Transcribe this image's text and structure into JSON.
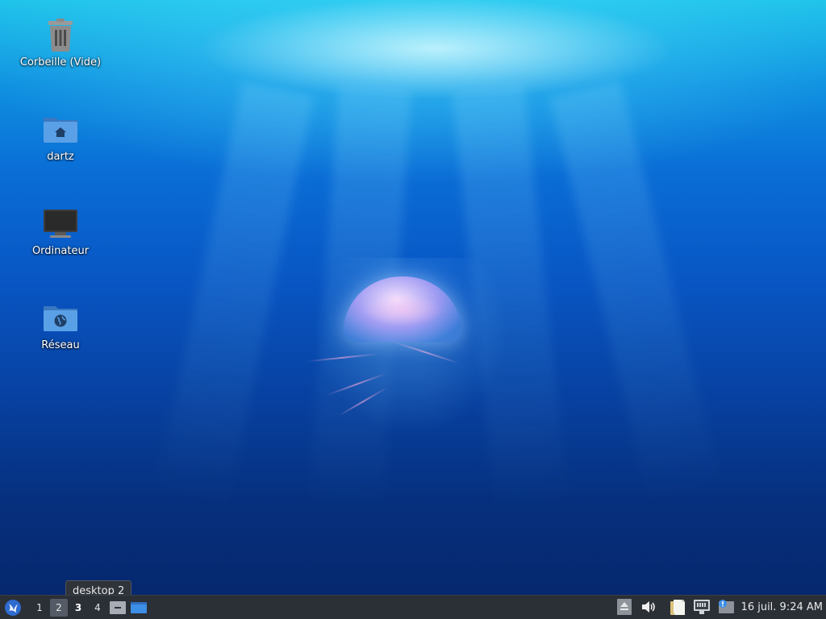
{
  "desktop": {
    "icons": [
      {
        "label": "Corbeille (Vide)",
        "icon": "trash-icon"
      },
      {
        "label": "dartz",
        "icon": "home-folder-icon"
      },
      {
        "label": "Ordinateur",
        "icon": "computer-icon"
      },
      {
        "label": "Réseau",
        "icon": "network-folder-icon"
      }
    ]
  },
  "taskbar": {
    "workspaces": [
      "1",
      "2",
      "3",
      "4"
    ],
    "active_workspace": "3",
    "hovered_workspace": "2",
    "clock": "16 juil. 9:24 AM"
  },
  "tooltip": {
    "text": "desktop 2"
  },
  "colors": {
    "taskbar_bg": "#2b2f36",
    "folder_blue": "#4a90d9",
    "accent": "#3d8ee6"
  }
}
